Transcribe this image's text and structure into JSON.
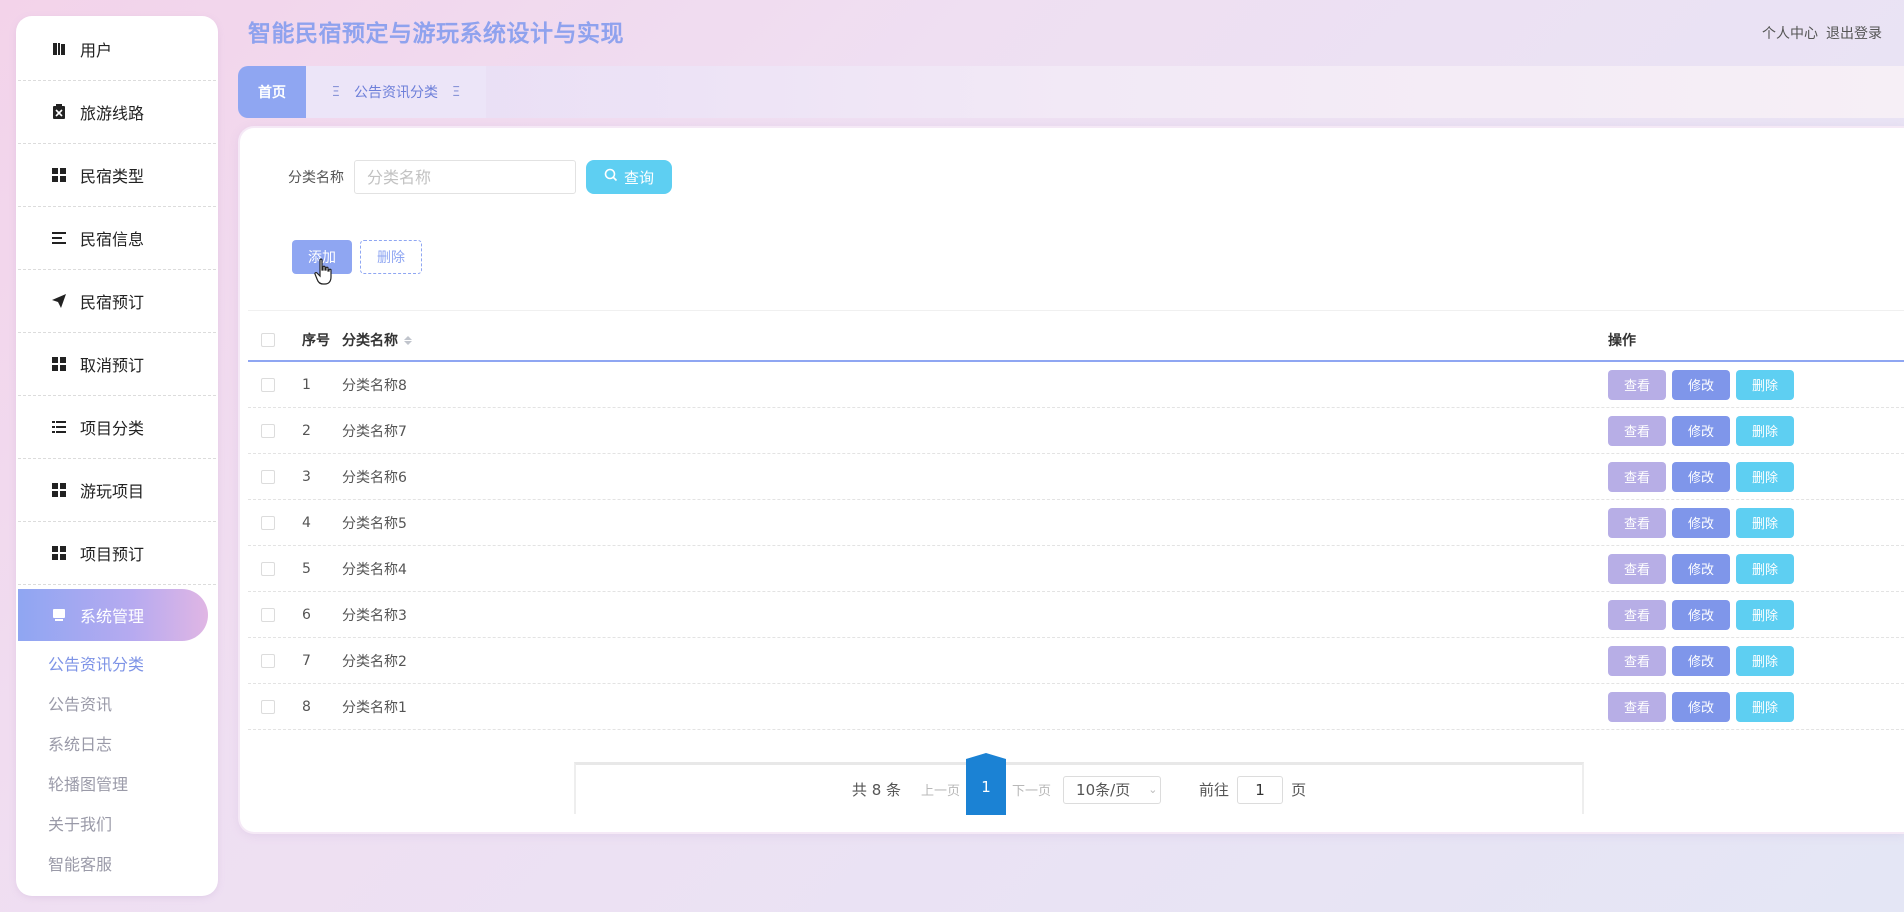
{
  "app": {
    "title": "智能民宿预定与游玩系统设计与实现",
    "header_links": [
      "个人中心",
      "退出登录"
    ]
  },
  "sidebar": {
    "items": [
      {
        "label": "用户",
        "icon": "book-icon"
      },
      {
        "label": "旅游线路",
        "icon": "clipboard-x-icon"
      },
      {
        "label": "民宿类型",
        "icon": "grid-icon"
      },
      {
        "label": "民宿信息",
        "icon": "list-lines-icon"
      },
      {
        "label": "民宿预订",
        "icon": "paper-plane-icon"
      },
      {
        "label": "取消预订",
        "icon": "grid-icon"
      },
      {
        "label": "项目分类",
        "icon": "list-icon"
      },
      {
        "label": "游玩项目",
        "icon": "grid-icon"
      },
      {
        "label": "项目预订",
        "icon": "grid-icon"
      }
    ],
    "active_group": {
      "label": "系统管理",
      "icon": "monitor-icon"
    },
    "submenu": [
      "公告资讯分类",
      "公告资讯",
      "系统日志",
      "轮播图管理",
      "关于我们",
      "智能客服"
    ],
    "active_sub_index": 0
  },
  "tabs": {
    "home": "首页",
    "current": "公告资讯分类",
    "tab_glyph": "Ξ"
  },
  "search": {
    "label": "分类名称",
    "placeholder": "分类名称",
    "value": "",
    "button": "查询"
  },
  "actions": {
    "add": "添加",
    "delete": "删除"
  },
  "table": {
    "headers": {
      "no": "序号",
      "name": "分类名称",
      "ops": "操作"
    },
    "rows": [
      {
        "no": "1",
        "name": "分类名称8"
      },
      {
        "no": "2",
        "name": "分类名称7"
      },
      {
        "no": "3",
        "name": "分类名称6"
      },
      {
        "no": "4",
        "name": "分类名称5"
      },
      {
        "no": "5",
        "name": "分类名称4"
      },
      {
        "no": "6",
        "name": "分类名称3"
      },
      {
        "no": "7",
        "name": "分类名称2"
      },
      {
        "no": "8",
        "name": "分类名称1"
      }
    ],
    "row_ops": {
      "view": "查看",
      "edit": "修改",
      "delete": "删除"
    }
  },
  "pagination": {
    "total": "共 8 条",
    "prev": "上一页",
    "current": "1",
    "next": "下一页",
    "page_size": "10条/页",
    "goto_label": "前往",
    "goto_value": "1",
    "goto_suffix": "页"
  },
  "colors": {
    "primary": "#8fa6f2",
    "accent_cyan": "#5ecff2",
    "view_btn": "#b7aee6",
    "edit_btn": "#7f96ea",
    "page_active": "#1b82d4"
  }
}
